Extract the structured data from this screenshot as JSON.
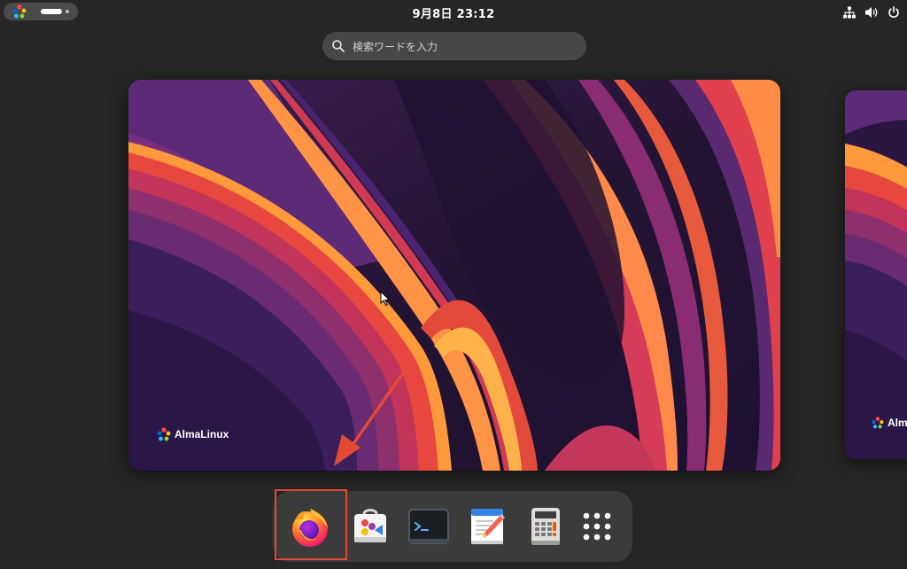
{
  "topbar": {
    "clock": "9月8日  23:12",
    "tray_icons": [
      "network-icon",
      "volume-icon",
      "power-icon"
    ]
  },
  "search": {
    "placeholder": "検索ワードを入力",
    "value": ""
  },
  "workspaces": {
    "main": {
      "brand_text": "AlmaLinux"
    },
    "next": {
      "brand_text": "AlmaLinux"
    }
  },
  "dash": {
    "items": [
      {
        "name": "Firefox",
        "icon": "firefox-icon",
        "highlighted": true
      },
      {
        "name": "Software",
        "icon": "software-store-icon"
      },
      {
        "name": "Terminal",
        "icon": "terminal-icon",
        "glyph": ">_"
      },
      {
        "name": "Text Editor",
        "icon": "text-editor-icon"
      },
      {
        "name": "Calculator",
        "icon": "calculator-icon"
      },
      {
        "name": "Show Applications",
        "icon": "app-grid-icon"
      }
    ]
  },
  "colors": {
    "highlight": "#e24a33",
    "arrow": "#e24a33",
    "background": "#262626",
    "dash_bg": "#3b3b3b",
    "search_bg": "#474747"
  }
}
